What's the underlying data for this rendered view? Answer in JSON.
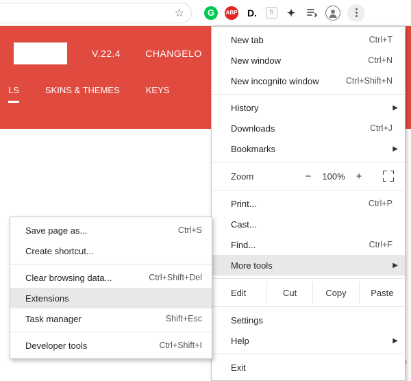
{
  "toolbar": {
    "star_title": "Bookmark",
    "extensions": [
      "G",
      "ABP",
      "D.",
      "fi",
      "puzzle",
      "playlist"
    ],
    "avatar_title": "You",
    "kebab_title": "Customize and control Google Chrome"
  },
  "page": {
    "version_label": "V.22.4",
    "changelog_label": "CHANGELO",
    "tabs": {
      "t0": "LS",
      "t1": "SKINS & THEMES",
      "t2": "KEYS"
    }
  },
  "menu": {
    "new_tab": {
      "label": "New tab",
      "shortcut": "Ctrl+T"
    },
    "new_window": {
      "label": "New window",
      "shortcut": "Ctrl+N"
    },
    "new_incognito": {
      "label": "New incognito window",
      "shortcut": "Ctrl+Shift+N"
    },
    "history": {
      "label": "History"
    },
    "downloads": {
      "label": "Downloads",
      "shortcut": "Ctrl+J"
    },
    "bookmarks": {
      "label": "Bookmarks"
    },
    "zoom": {
      "label": "Zoom",
      "minus": "−",
      "value": "100%",
      "plus": "+"
    },
    "print": {
      "label": "Print...",
      "shortcut": "Ctrl+P"
    },
    "cast": {
      "label": "Cast..."
    },
    "find": {
      "label": "Find...",
      "shortcut": "Ctrl+F"
    },
    "more_tools": {
      "label": "More tools"
    },
    "edit": {
      "label": "Edit",
      "cut": "Cut",
      "copy": "Copy",
      "paste": "Paste"
    },
    "settings": {
      "label": "Settings"
    },
    "help": {
      "label": "Help"
    },
    "exit": {
      "label": "Exit"
    }
  },
  "submenu": {
    "save_page": {
      "label": "Save page as...",
      "shortcut": "Ctrl+S"
    },
    "create_shortcut": {
      "label": "Create shortcut..."
    },
    "clear_data": {
      "label": "Clear browsing data...",
      "shortcut": "Ctrl+Shift+Del"
    },
    "extensions": {
      "label": "Extensions"
    },
    "task_manager": {
      "label": "Task manager",
      "shortcut": "Shift+Esc"
    },
    "dev_tools": {
      "label": "Developer tools",
      "shortcut": "Ctrl+Shift+I"
    }
  },
  "watermark": "wsxdn.com"
}
